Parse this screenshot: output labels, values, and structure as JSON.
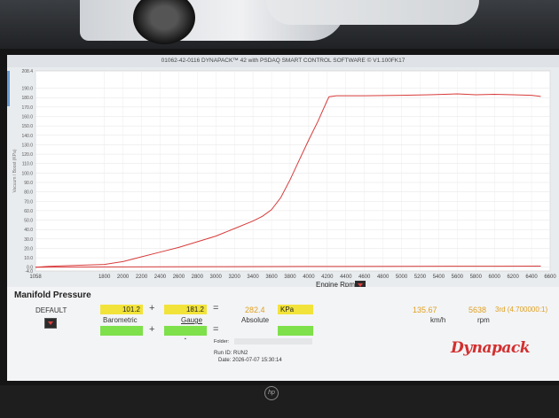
{
  "window": {
    "title": "01062-42-0116 DYNAPACK™ 42 with PSDAQ SMART CONTROL SOFTWARE © V1.100FK17"
  },
  "chart_data": {
    "type": "line",
    "title": "",
    "xlabel": "Engine Rpm",
    "ylabel": "Vacuum / Boost (KPa)",
    "xlim": [
      1058,
      6600
    ],
    "ylim": [
      -4,
      208.4
    ],
    "x_ticks": [
      "1058",
      "1800",
      "2000",
      "2200",
      "2400",
      "2600",
      "2800",
      "3000",
      "3200",
      "3400",
      "3600",
      "3800",
      "4000",
      "4200",
      "4400",
      "4600",
      "4800",
      "5000",
      "5200",
      "5400",
      "5600",
      "5800",
      "6000",
      "6200",
      "6400",
      "6600"
    ],
    "y_ticks": [
      "208.4",
      "190.0",
      "180.0",
      "170.0",
      "160.0",
      "150.0",
      "140.0",
      "130.0",
      "120.0",
      "110.0",
      "100.0",
      "90.0",
      "80.0",
      "70.0",
      "60.0",
      "50.0",
      "40.0",
      "30.0",
      "20.0",
      "10.0",
      "0.0",
      "-4.0"
    ],
    "grid": true,
    "series": [
      {
        "color": "#d83a3a",
        "x": [
          1058,
          1200,
          1500,
          1800,
          2000,
          2200,
          2400,
          2600,
          2800,
          3000,
          3200,
          3400,
          3500,
          3600,
          3700,
          3800,
          3900,
          4000,
          4100,
          4200,
          4220,
          4300,
          4600,
          5000,
          5300,
          5600,
          5800,
          6000,
          6200,
          6400,
          6500
        ],
        "y": [
          0,
          1,
          2,
          3,
          6,
          11,
          16,
          21,
          27,
          33,
          41,
          49,
          54,
          61,
          74,
          93,
          114,
          135,
          155,
          177,
          181,
          182,
          182,
          182.5,
          183,
          184,
          183,
          183.5,
          183,
          182.5,
          181.2
        ]
      },
      {
        "color": "#d83a3a",
        "x": [
          1058,
          2000,
          3000,
          4000,
          5000,
          6000,
          6500
        ],
        "y": [
          0,
          0.3,
          0.6,
          0.8,
          1.0,
          1.1,
          1.2
        ]
      }
    ]
  },
  "axis_title": "Engine Rpm",
  "section_title": "Manifold Pressure",
  "left_label": "DEFAULT",
  "barometric": {
    "value": "101.2",
    "label": "Barometric"
  },
  "gauge": {
    "value": "181.2",
    "label": "Gauge"
  },
  "absolute": {
    "value": "282.4",
    "unit": "KPa",
    "label": "Absolute"
  },
  "speed": {
    "value": "135.67",
    "unit": "km/h"
  },
  "rpm": {
    "value": "5638",
    "unit": "rpm"
  },
  "gear": "3rd (4.700000:1)",
  "ops": {
    "plus": "+",
    "equals": "="
  },
  "folder_label": "Folder:",
  "run_id": "Run ID: RUN2",
  "date": "Date: 2026-07-07 15:30:14",
  "logo_text": "Dynapack",
  "colors": {
    "accent": "#d83a3a",
    "yellow": "#f2e33a",
    "green": "#7ee04a"
  }
}
